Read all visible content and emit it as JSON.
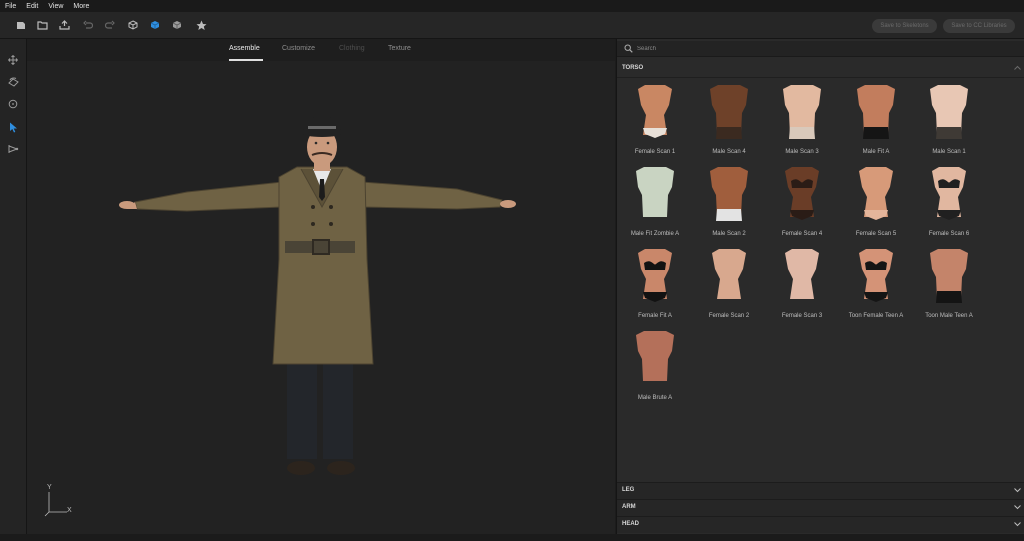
{
  "menubar": {
    "items": [
      "File",
      "Edit",
      "View",
      "More"
    ]
  },
  "toolbar": {
    "icons": [
      "new-icon",
      "open-folder-icon",
      "import-icon",
      "undo-icon",
      "redo-icon",
      "cube-outline-icon",
      "cube-solid-icon",
      "cube-shaded-icon",
      "star-icon"
    ],
    "save_to_skeletons_label": "Save to Skeletons",
    "save_to_library_label": "Save to CC Libraries"
  },
  "left_rail": {
    "icons": [
      "move-icon",
      "orbit-icon",
      "rotate-icon",
      "select-cursor-icon",
      "camera-icon"
    ]
  },
  "tabs": [
    {
      "label": "Assemble",
      "state": "active"
    },
    {
      "label": "Customize",
      "state": "normal"
    },
    {
      "label": "Clothing",
      "state": "disabled"
    },
    {
      "label": "Texture",
      "state": "normal"
    }
  ],
  "axis": {
    "y_label": "Y",
    "x_label": "X"
  },
  "search": {
    "placeholder": "Search",
    "value": ""
  },
  "sections": {
    "torso": "TORSO",
    "leg": "LEG",
    "arm": "ARM",
    "head": "HEAD"
  },
  "torso_items": [
    {
      "label": "Female Scan 1",
      "skin": "#c98763",
      "garment": "underwear",
      "garment_color": "#e8e0d8",
      "shape": "female"
    },
    {
      "label": "Male Scan 4",
      "skin": "#6e4129",
      "garment": "shorts",
      "garment_color": "#3b2a20",
      "shape": "male"
    },
    {
      "label": "Male Scan 3",
      "skin": "#e2b9a0",
      "garment": "shorts",
      "garment_color": "#d9c9bb",
      "shape": "male"
    },
    {
      "label": "Male Fit A",
      "skin": "#c27d5d",
      "garment": "shorts",
      "garment_color": "#151515",
      "shape": "male"
    },
    {
      "label": "Male Scan 1",
      "skin": "#e8c7b4",
      "garment": "shorts",
      "garment_color": "#3f3a35",
      "shape": "male"
    },
    {
      "label": "Male Fit Zombie A",
      "skin": "#c9d4c2",
      "garment": "none",
      "garment_color": "#c9d4c2",
      "shape": "male"
    },
    {
      "label": "Male Scan 2",
      "skin": "#a05e3d",
      "garment": "shorts",
      "garment_color": "#e3e3e3",
      "shape": "male"
    },
    {
      "label": "Female Scan 4",
      "skin": "#6a3d27",
      "garment": "bikini",
      "garment_color": "#2a1c16",
      "shape": "female"
    },
    {
      "label": "Female Scan 5",
      "skin": "#d79a79",
      "garment": "underwear",
      "garment_color": "#e4b59b",
      "shape": "female"
    },
    {
      "label": "Female Scan 6",
      "skin": "#e1b7a0",
      "garment": "bikini",
      "garment_color": "#202020",
      "shape": "female"
    },
    {
      "label": "Female Fit A",
      "skin": "#c9876a",
      "garment": "bikini",
      "garment_color": "#121212",
      "shape": "female"
    },
    {
      "label": "Female Scan 2",
      "skin": "#d8a88e",
      "garment": "none",
      "garment_color": "#d8a88e",
      "shape": "female"
    },
    {
      "label": "Female Scan 3",
      "skin": "#e0b8a6",
      "garment": "none",
      "garment_color": "#e0b8a6",
      "shape": "female"
    },
    {
      "label": "Toon Female Teen A",
      "skin": "#d49377",
      "garment": "bikini",
      "garment_color": "#151515",
      "shape": "female"
    },
    {
      "label": "Toon Male Teen A",
      "skin": "#c4846a",
      "garment": "shorts",
      "garment_color": "#141414",
      "shape": "male"
    },
    {
      "label": "Male Brute A",
      "skin": "#b4705a",
      "garment": "none",
      "garment_color": "#b4705a",
      "shape": "male"
    }
  ],
  "colors": {
    "accent": "#2f8fe0",
    "coat": "#6f6244",
    "trousers": "#23262b",
    "hat": "#222222",
    "skin": "#c99a7d"
  }
}
